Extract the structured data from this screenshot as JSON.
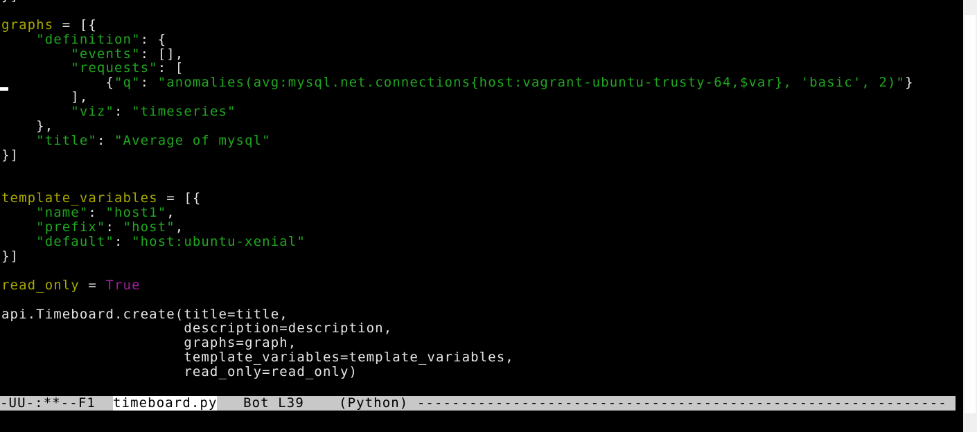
{
  "colors": {
    "background": "#000000",
    "default_text": "#e6e6e6",
    "variable": "#a8a800",
    "string": "#1fa81f",
    "constant": "#a020a0",
    "modeline_bg": "#c8c8c8"
  },
  "code_lines": [
    [
      {
        "t": "}]",
        "c": "default"
      }
    ],
    [],
    [
      {
        "t": "graphs",
        "c": "var"
      },
      {
        "t": " = [{",
        "c": "default"
      }
    ],
    [
      {
        "t": "    ",
        "c": "default"
      },
      {
        "t": "\"definition\"",
        "c": "str"
      },
      {
        "t": ": {",
        "c": "default"
      }
    ],
    [
      {
        "t": "        ",
        "c": "default"
      },
      {
        "t": "\"events\"",
        "c": "str"
      },
      {
        "t": ": [],",
        "c": "default"
      }
    ],
    [
      {
        "t": "        ",
        "c": "default"
      },
      {
        "t": "\"requests\"",
        "c": "str"
      },
      {
        "t": ": [",
        "c": "default"
      }
    ],
    [
      {
        "t": "            {",
        "c": "default"
      },
      {
        "t": "\"q\"",
        "c": "str"
      },
      {
        "t": ": ",
        "c": "default"
      },
      {
        "t": "\"anomalies(avg:mysql.net.connections{host:vagrant-ubuntu-trusty-64,$var}, 'basic', 2)\"",
        "c": "str"
      },
      {
        "t": "}",
        "c": "default"
      }
    ],
    [
      {
        "t": "        ],",
        "c": "default"
      }
    ],
    [
      {
        "t": "        ",
        "c": "default"
      },
      {
        "t": "\"viz\"",
        "c": "str"
      },
      {
        "t": ": ",
        "c": "default"
      },
      {
        "t": "\"timeseries\"",
        "c": "str"
      }
    ],
    [
      {
        "t": "    },",
        "c": "default"
      }
    ],
    [
      {
        "t": "    ",
        "c": "default"
      },
      {
        "t": "\"title\"",
        "c": "str"
      },
      {
        "t": ": ",
        "c": "default"
      },
      {
        "t": "\"Average of mysql\"",
        "c": "str"
      }
    ],
    [
      {
        "t": "}]",
        "c": "default"
      }
    ],
    [],
    [],
    [
      {
        "t": "template_variables",
        "c": "var"
      },
      {
        "t": " = [{",
        "c": "default"
      }
    ],
    [
      {
        "t": "    ",
        "c": "default"
      },
      {
        "t": "\"name\"",
        "c": "str"
      },
      {
        "t": ": ",
        "c": "default"
      },
      {
        "t": "\"host1\"",
        "c": "str"
      },
      {
        "t": ",",
        "c": "default"
      }
    ],
    [
      {
        "t": "    ",
        "c": "default"
      },
      {
        "t": "\"prefix\"",
        "c": "str"
      },
      {
        "t": ": ",
        "c": "default"
      },
      {
        "t": "\"host\"",
        "c": "str"
      },
      {
        "t": ",",
        "c": "default"
      }
    ],
    [
      {
        "t": "    ",
        "c": "default"
      },
      {
        "t": "\"default\"",
        "c": "str"
      },
      {
        "t": ": ",
        "c": "default"
      },
      {
        "t": "\"host:ubuntu-xenial\"",
        "c": "str"
      }
    ],
    [
      {
        "t": "}]",
        "c": "default"
      }
    ],
    [],
    [
      {
        "t": "read_only",
        "c": "var"
      },
      {
        "t": " = ",
        "c": "default"
      },
      {
        "t": "True",
        "c": "const"
      }
    ],
    [],
    [
      {
        "t": "api.Timeboard.create(title=title,",
        "c": "default"
      }
    ],
    [
      {
        "t": "                     description=description,",
        "c": "default"
      }
    ],
    [
      {
        "t": "                     graphs=graph,",
        "c": "default"
      }
    ],
    [
      {
        "t": "                     template_variables=template_variables,",
        "c": "default"
      }
    ],
    [
      {
        "t": "                     read_only=read_only)",
        "c": "default"
      }
    ]
  ],
  "modeline": {
    "prefix": "-UU-:**--F1  ",
    "buffer_name": "timeboard.py",
    "position": "   Bot L39    ",
    "mode": "(Python) ",
    "fill": "-------------------------------------------------------------"
  }
}
